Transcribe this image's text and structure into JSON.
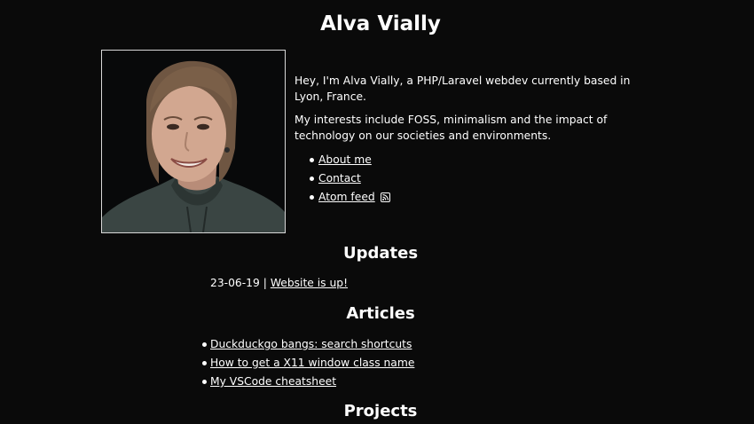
{
  "site": {
    "name": "Alva Vially"
  },
  "profile": {
    "photo_alt": "Portrait of Alva Vially",
    "intro": "Hey, I'm Alva Vially, a PHP/Laravel webdev currently based in Lyon, France.",
    "interests": "My interests include FOSS, minimalism and the impact of technology on our societies and environments."
  },
  "links": [
    {
      "label": "About me"
    },
    {
      "label": "Contact"
    },
    {
      "label": "Atom feed",
      "icon": "rss-icon"
    }
  ],
  "updates": {
    "heading": "Updates",
    "items": [
      {
        "date": "23-06-19",
        "separator": "|",
        "label": "Website is up!"
      }
    ]
  },
  "articles": {
    "heading": "Articles",
    "items": [
      {
        "label": "Duckduckgo bangs: search shortcuts"
      },
      {
        "label": "How to get a X11 window class name"
      },
      {
        "label": "My VSCode cheatsheet"
      }
    ]
  },
  "projects": {
    "heading": "Projects"
  },
  "colors": {
    "background": "#0a0a0a",
    "text": "#ffffff",
    "photo_border": "#d8d8d8"
  }
}
